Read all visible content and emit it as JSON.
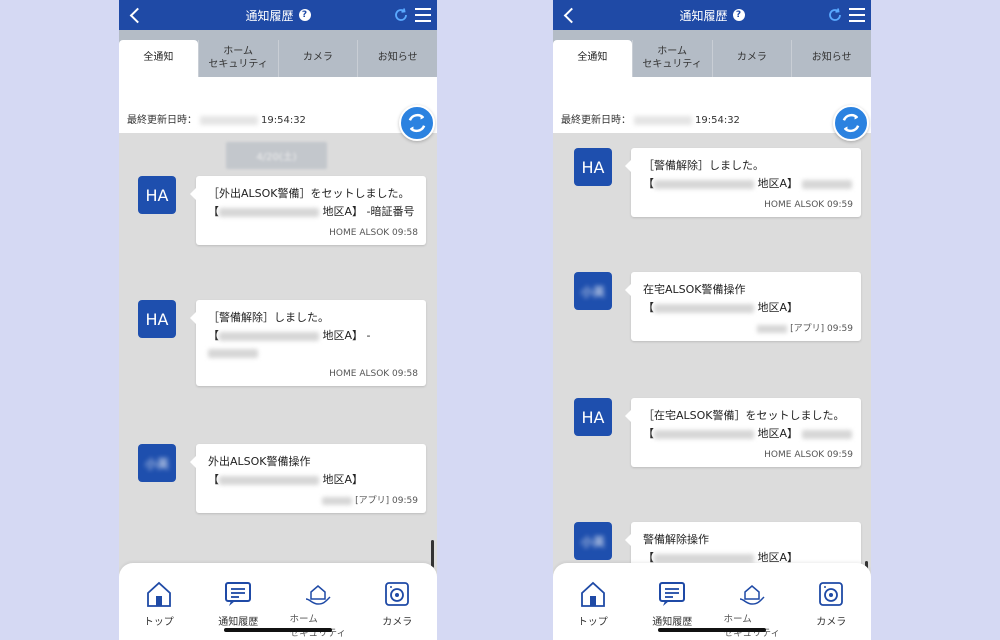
{
  "colors": {
    "background": "#d5d9f3",
    "header": "#1f4aa6",
    "accent": "#2b82e0",
    "avatar": "#1e4fae",
    "feed": "#dcdcdc"
  },
  "screens": [
    {
      "header": {
        "title": "通知履歴",
        "help": "?"
      },
      "tabs": [
        {
          "label": "全通知",
          "active": true
        },
        {
          "label": "ホーム\nセキュリティ"
        },
        {
          "label": "カメラ"
        },
        {
          "label": "お知らせ"
        }
      ],
      "update": {
        "label": "最終更新日時：",
        "time": "19:54:32"
      },
      "date_chip": "4/20(土)",
      "notifications": [
        {
          "avatar": "HA",
          "line1": "［外出ALSOK警備］をセットしました。",
          "line2a": "【",
          "line2b": " 地区A】 -暗証番号",
          "line3": "",
          "meta": "HOME ALSOK 09:58"
        },
        {
          "avatar": "HA",
          "line1": "［警備解除］しました。",
          "line2a": "【",
          "line2b": " 地区A】 -",
          "line3": "",
          "meta": "HOME ALSOK 09:58"
        },
        {
          "avatar": "小英",
          "line1": "外出ALSOK警備操作",
          "line2a": "【",
          "line2b": " 地区A】",
          "line3": "",
          "meta": "[アプリ] 09:59"
        }
      ],
      "nav": [
        {
          "label": "トップ",
          "icon": "house-icon"
        },
        {
          "label": "通知履歴",
          "icon": "message-icon"
        },
        {
          "label": "ホーム\nセキュリティ",
          "icon": "home-security-icon"
        },
        {
          "label": "カメラ",
          "icon": "camera-icon"
        }
      ]
    },
    {
      "header": {
        "title": "通知履歴",
        "help": "?"
      },
      "tabs": [
        {
          "label": "全通知",
          "active": true
        },
        {
          "label": "ホーム\nセキュリティ"
        },
        {
          "label": "カメラ"
        },
        {
          "label": "お知らせ"
        }
      ],
      "update": {
        "label": "最終更新日時：",
        "time": "19:54:32"
      },
      "notifications": [
        {
          "avatar": "HA",
          "line1": "［警備解除］しました。",
          "line2a": "【",
          "line2b": " 地区A】",
          "line3": "",
          "meta": "HOME ALSOK 09:59"
        },
        {
          "avatar": "小英",
          "line1": "在宅ALSOK警備操作",
          "line2a": "【",
          "line2b": " 地区A】",
          "line3": "",
          "meta": "[アプリ] 09:59"
        },
        {
          "avatar": "HA",
          "line1": "［在宅ALSOK警備］をセットしました。",
          "line2a": "【",
          "line2b": " 地区A】",
          "line3": "",
          "meta": "HOME ALSOK 09:59"
        },
        {
          "avatar": "小英",
          "line1": "警備解除操作",
          "line2a": "【",
          "line2b": " 地区A】",
          "line3": "",
          "meta": ""
        }
      ],
      "nav": [
        {
          "label": "トップ",
          "icon": "house-icon"
        },
        {
          "label": "通知履歴",
          "icon": "message-icon"
        },
        {
          "label": "ホーム\nセキュリティ",
          "icon": "home-security-icon"
        },
        {
          "label": "カメラ",
          "icon": "camera-icon"
        }
      ]
    }
  ]
}
